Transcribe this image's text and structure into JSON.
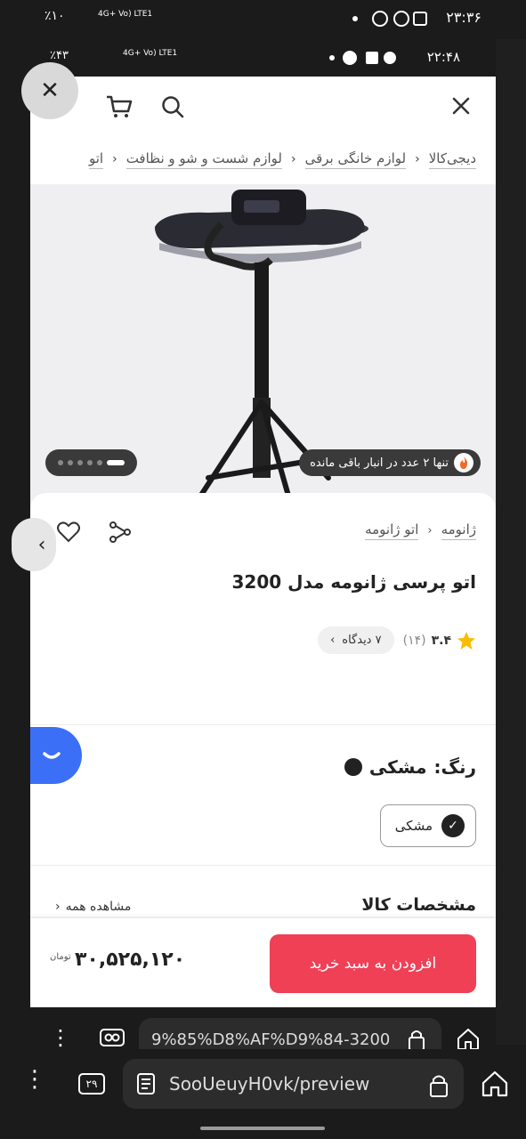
{
  "outer_status": {
    "time": "۲۳:۳۶",
    "battery": "٪۱۰",
    "network": "4G+ Vo) LTE1"
  },
  "inner_status": {
    "time": "۲۲:۴۸",
    "battery": "٪۴۳",
    "network": "4G+ Vo) LTE1"
  },
  "breadcrumb": [
    "دیجی‌کالا",
    "لوازم خانگی برقی",
    "لوازم شست و شو و نظافت",
    "اتو"
  ],
  "stock_badge": "تنها ۲ عدد در انبار باقی مانده",
  "product": {
    "sub_crumbs": [
      "ژانومه",
      "اتو ژانومه"
    ],
    "title": "اتو پرسی ژانومه مدل 3200",
    "rating": "۳.۴",
    "rating_count": "(۱۴)",
    "reviews": "۷ دیدگاه",
    "color_label": "رنگ:",
    "color_name": "مشکی",
    "color_option": "مشکی"
  },
  "specs": {
    "title": "مشخصات کالا",
    "view_all": "مشاهده همه"
  },
  "buy": {
    "add_to_cart": "افزودن به سبد خرید",
    "price": "۳۰,۵۲۵,۱۲۰",
    "currency": "تومان"
  },
  "inner_url": "9%85%D8%AF%D9%84-3200",
  "outer_url": "SooUeuyH0vk/preview",
  "outer_tab_count": "۲۹",
  "colors": {
    "accent": "#ef4056",
    "chat": "#3b6ff6",
    "star": "#f9bc00"
  }
}
